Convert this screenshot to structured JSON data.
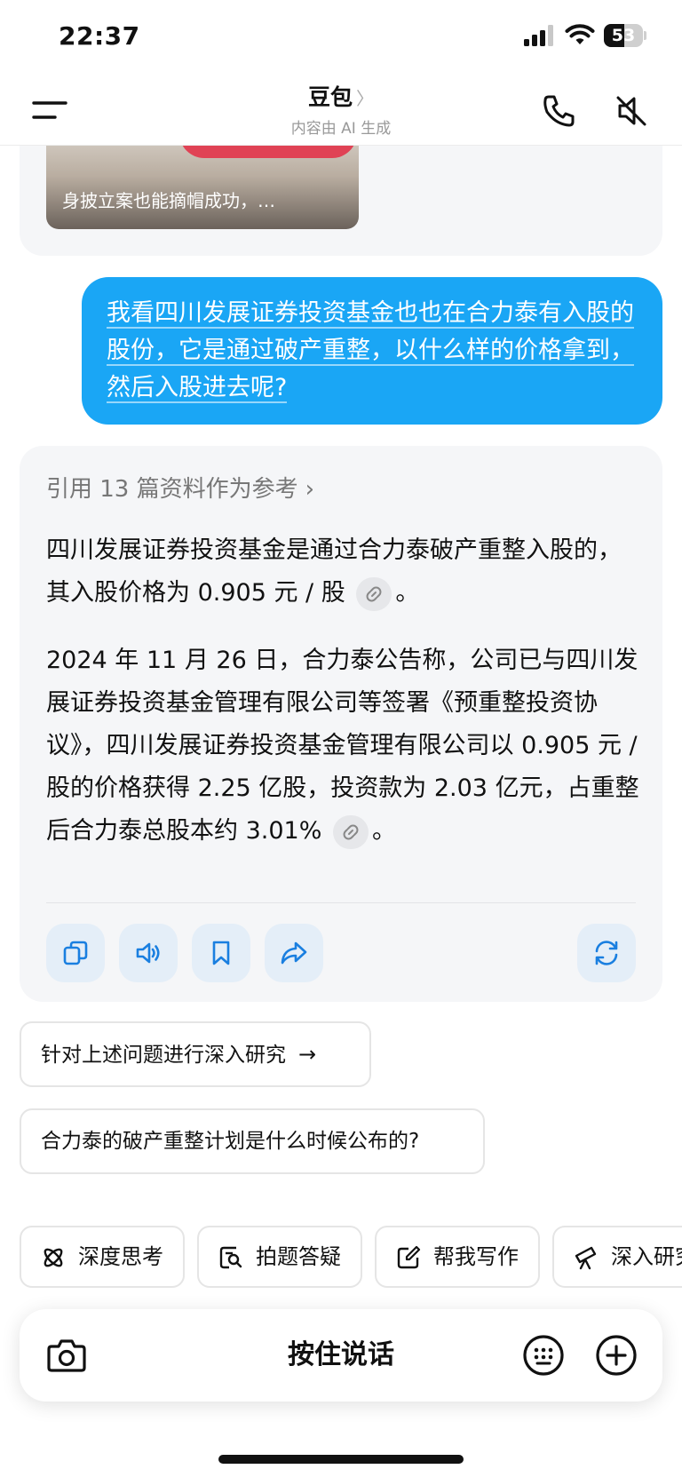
{
  "status": {
    "time": "22:37",
    "battery": "53",
    "battery_level": 0.53
  },
  "nav": {
    "title": "豆包",
    "chevron": "〉",
    "subtitle": "内容由 AI 生成"
  },
  "previous_card": {
    "caption": "身披立案也能摘帽成功，…"
  },
  "user_message": {
    "text": "我看四川发展证券投资基金也也在合力泰有入股的股份，它是通过破产重整，以什么样的价格拿到，然后入股进去呢?"
  },
  "answer": {
    "refs_label": "引用 13 篇资料作为参考",
    "refs_chevron": "›",
    "para1": "四川发展证券投资基金是通过合力泰破产重整入股的，其入股价格为 0.905 元 / 股",
    "para1_end": "。",
    "para2": "2024 年 11 月 26 日，合力泰公告称，公司已与四川发展证券投资基金管理有限公司等签署《预重整投资协议》，四川发展证券投资基金管理有限公司以 0.905 元 / 股的价格获得 2.25 亿股，投资款为 2.03 亿元，占重整后合力泰总股本约 3.01%",
    "para2_end": "。",
    "actions": [
      "copy-icon",
      "speaker-icon",
      "bookmark-icon",
      "share-icon",
      "regenerate-icon"
    ]
  },
  "suggestions": [
    {
      "text": "针对上述问题进行深入研究",
      "arrow": "→"
    },
    {
      "text": "合力泰的破产重整计划是什么时候公布的?"
    }
  ],
  "chips": [
    {
      "label": "深度思考",
      "icon": "deep-think-icon"
    },
    {
      "label": "拍题答疑",
      "icon": "photo-question-icon"
    },
    {
      "label": "帮我写作",
      "icon": "write-icon"
    },
    {
      "label": "深入研究",
      "icon": "telescope-icon"
    }
  ],
  "input": {
    "hold_to_talk": "按住说话"
  },
  "colors": {
    "accent": "#1aa6f5",
    "card_bg": "#f5f6f8",
    "action_bg": "#e4eef8",
    "action_icon": "#1a7fe0"
  }
}
